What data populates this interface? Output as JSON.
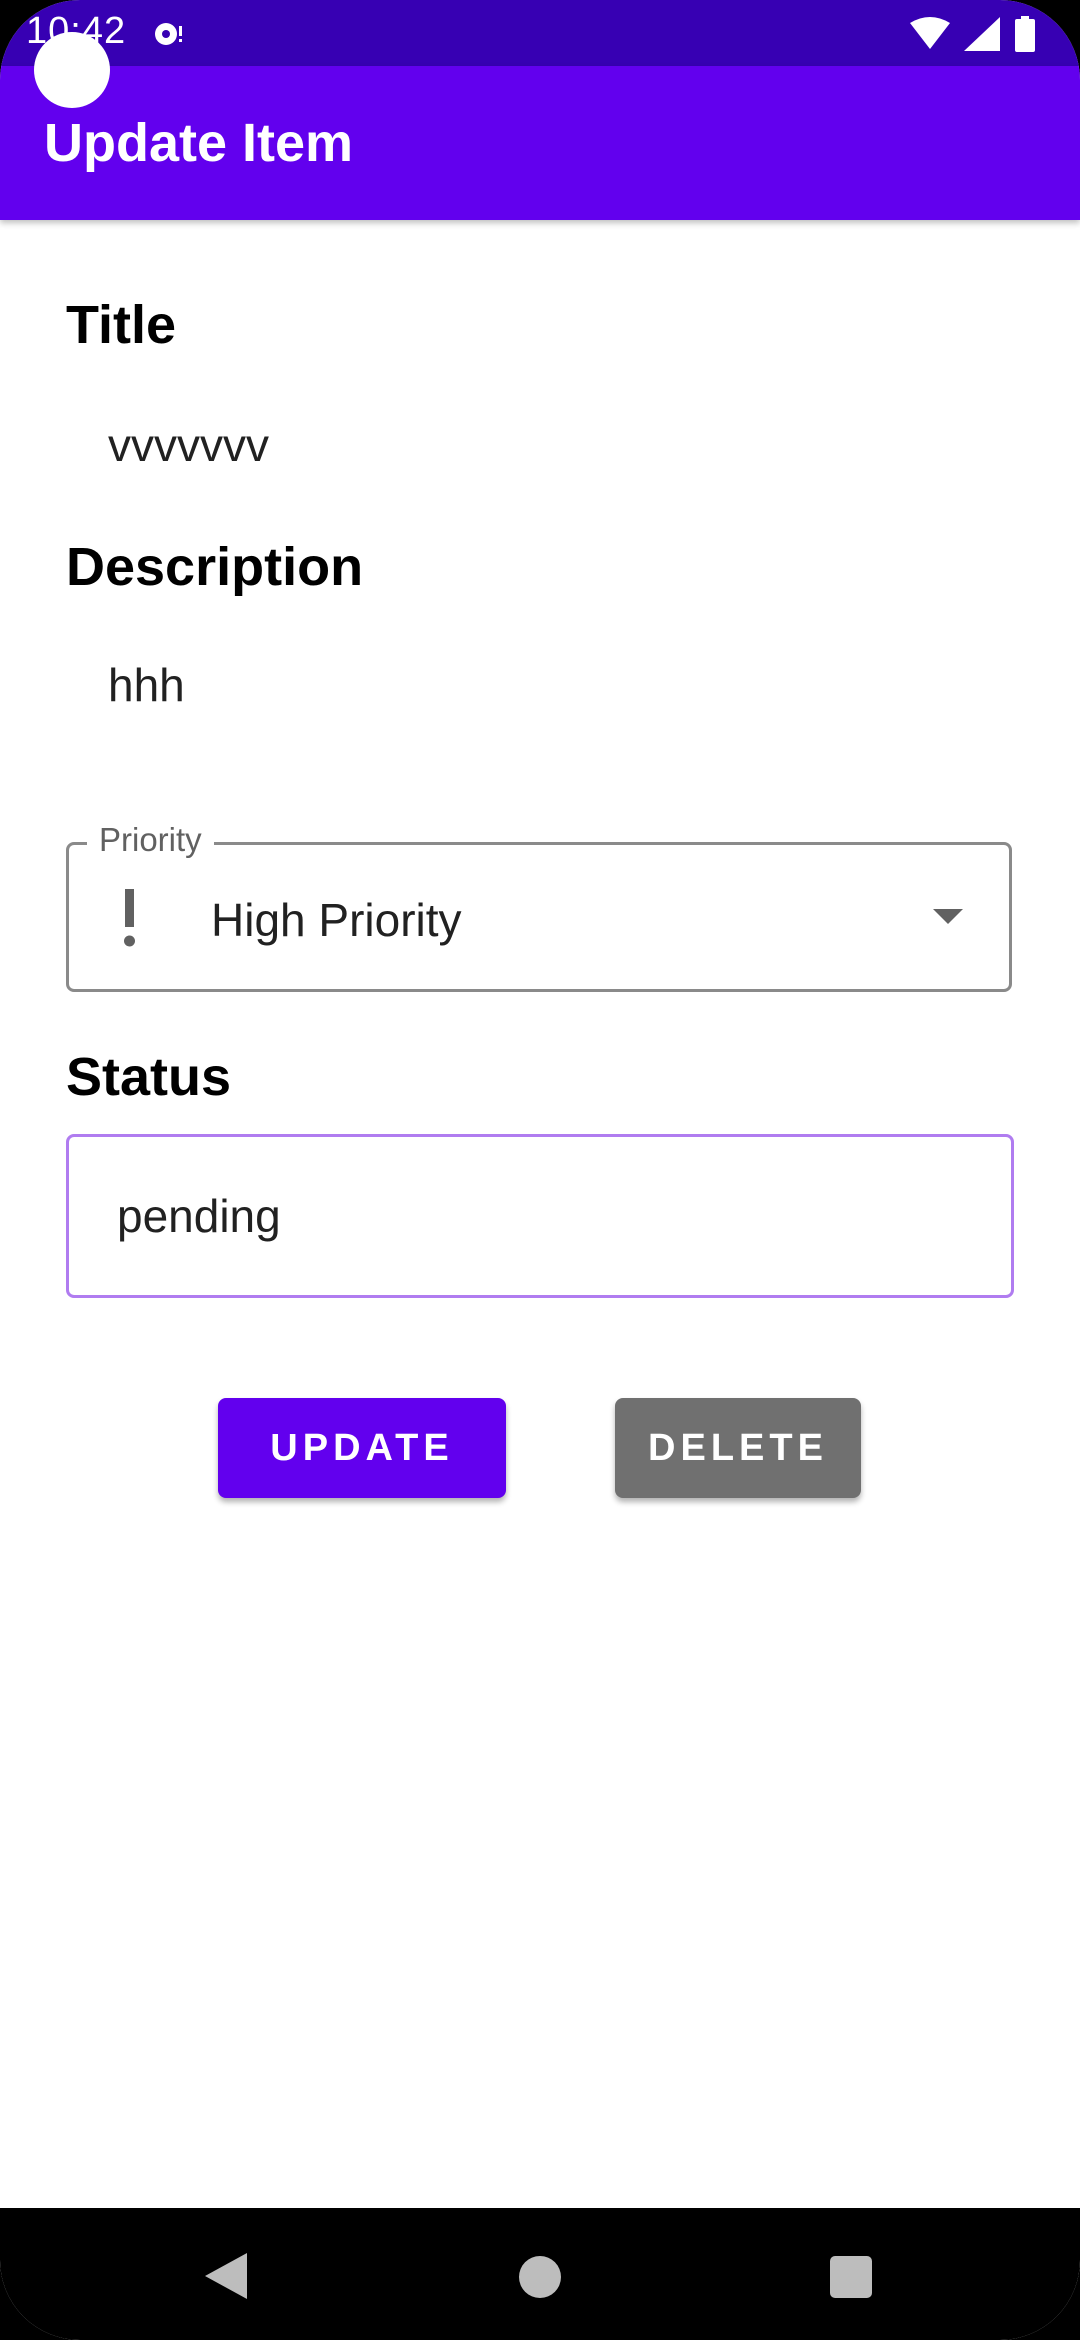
{
  "status_bar": {
    "time": "10:42",
    "icons": [
      "media-notification-icon",
      "wifi-icon",
      "signal-icon",
      "battery-icon"
    ]
  },
  "app_bar": {
    "title": "Update Item"
  },
  "form": {
    "title_label": "Title",
    "title_value": "vvvvvvv",
    "description_label": "Description",
    "description_value": "hhh",
    "priority": {
      "legend": "Priority",
      "selected": "High Priority",
      "icon": "priority-high-icon"
    },
    "status_label": "Status",
    "status_value": "pending"
  },
  "actions": {
    "update_label": "UPDATE",
    "delete_label": "DELETE"
  },
  "nav_bar": {
    "icons": [
      "back-icon",
      "home-icon",
      "recents-icon"
    ]
  },
  "colors": {
    "status_bar": "#3700B3",
    "app_bar": "#6200EE",
    "update_button": "#6200EE",
    "delete_button": "#707070",
    "status_outline": "#B07CF0"
  }
}
